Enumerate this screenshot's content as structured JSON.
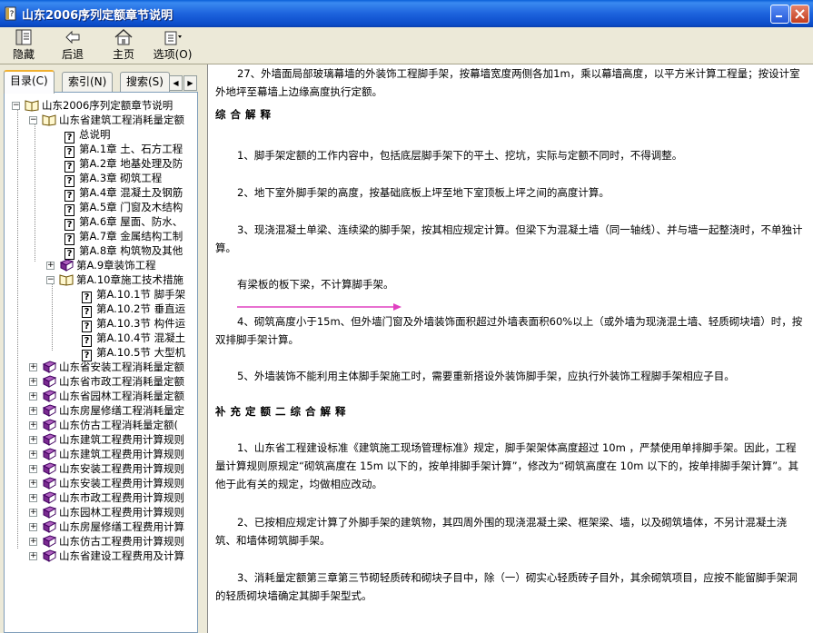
{
  "window": {
    "title": "山东2006序列定额章节说明"
  },
  "toolbar": {
    "hide": "隐藏",
    "back": "后退",
    "home": "主页",
    "options": "选项(O)"
  },
  "tabs": {
    "contents": "目录(C)",
    "index": "索引(N)",
    "search": "搜索(S)"
  },
  "tree": {
    "root": "山东2006序列定额章节说明",
    "book1": "山东省建筑工程消耗量定额",
    "overview": "总说明",
    "ch1": "第A.1章 土、石方工程",
    "ch2": "第A.2章 地基处理及防",
    "ch3": "第A.3章 砌筑工程",
    "ch4": "第A.4章 混凝土及钢筋",
    "ch5": "第A.5章 门窗及木结构",
    "ch6": "第A.6章 屋面、防水、",
    "ch7": "第A.7章 金属结构工制",
    "ch8": "第A.8章 构筑物及其他",
    "ch9": "第A.9章装饰工程",
    "ch10": "第A.10章施工技术措施",
    "s1": "第A.10.1节 脚手架",
    "s2": "第A.10.2节 垂直运",
    "s3": "第A.10.3节 构件运",
    "s4": "第A.10.4节 混凝土",
    "s5": "第A.10.5节 大型机",
    "b2": "山东省安装工程消耗量定额",
    "b3": "山东省市政工程消耗量定额",
    "b4": "山东省园林工程消耗量定额",
    "b5": "山东房屋修缮工程消耗量定",
    "b6": "山东仿古工程消耗量定额(",
    "b7": "山东建筑工程费用计算规则",
    "b8": "山东建筑工程费用计算规则",
    "b9": "山东安装工程费用计算规则",
    "b10": "山东安装工程费用计算规则",
    "b11": "山东市政工程费用计算规则",
    "b12": "山东园林工程费用计算规则",
    "b13": "山东房屋修缮工程费用计算",
    "b14": "山东仿古工程费用计算规则",
    "b15": "山东省建设工程费用及计算"
  },
  "content": {
    "p0": "27、外墙面局部玻璃幕墙的外装饰工程脚手架，按幕墙宽度两侧各加1m，乘以幕墙高度，以平方米计算工程量；按设计室外地坪至幕墙上边缘高度执行定额。",
    "h1": "综合解释",
    "p1": "1、脚手架定额的工作内容中，包括底层脚手架下的平土、挖坑，实际与定额不同时，不得调整。",
    "p2": "2、地下室外脚手架的高度，按基础底板上坪至地下室顶板上坪之间的高度计算。",
    "p3": "3、现浇混凝土单梁、连续梁的脚手架，按其相应规定计算。但梁下为混凝土墙（同一轴线）、并与墙一起整浇时，不单独计算。",
    "p3b": "有梁板的板下梁，不计算脚手架。",
    "p4": "4、砌筑高度小于15m、但外墙门窗及外墙装饰面积超过外墙表面积60%以上（或外墙为现浇混土墙、轻质砌块墙）时，按双排脚手架计算。",
    "p5": "5、外墙装饰不能利用主体脚手架施工时，需要重新搭设外装饰脚手架，应执行外装饰工程脚手架相应子目。",
    "h2": "补充定额二综合解释",
    "p6": "1、山东省工程建设标准《建筑施工现场管理标准》规定，脚手架架体高度超过 10m ，严禁使用单排脚手架。因此，工程量计算规则原规定“砌筑高度在 15m 以下的，按单排脚手架计算”，修改为“砌筑高度在 10m 以下的，按单排脚手架计算”。其他于此有关的规定，均做相应改动。",
    "p7": "2、已按相应规定计算了外脚手架的建筑物，其四周外围的现浇混凝土梁、框架梁、墙，以及砌筑墙体，不另计混凝土浇筑、和墙体砌筑脚手架。",
    "p8": "3、消耗量定额第三章第三节砌轻质砖和砌块子目中，除（一）砌实心轻质砖子目外，其余砌筑项目，应按不能留脚手架洞的轻质砌块墙确定其脚手架型式。"
  },
  "colors": {
    "arrow": "#e040c0",
    "titlebar": "#0a5fd8"
  }
}
